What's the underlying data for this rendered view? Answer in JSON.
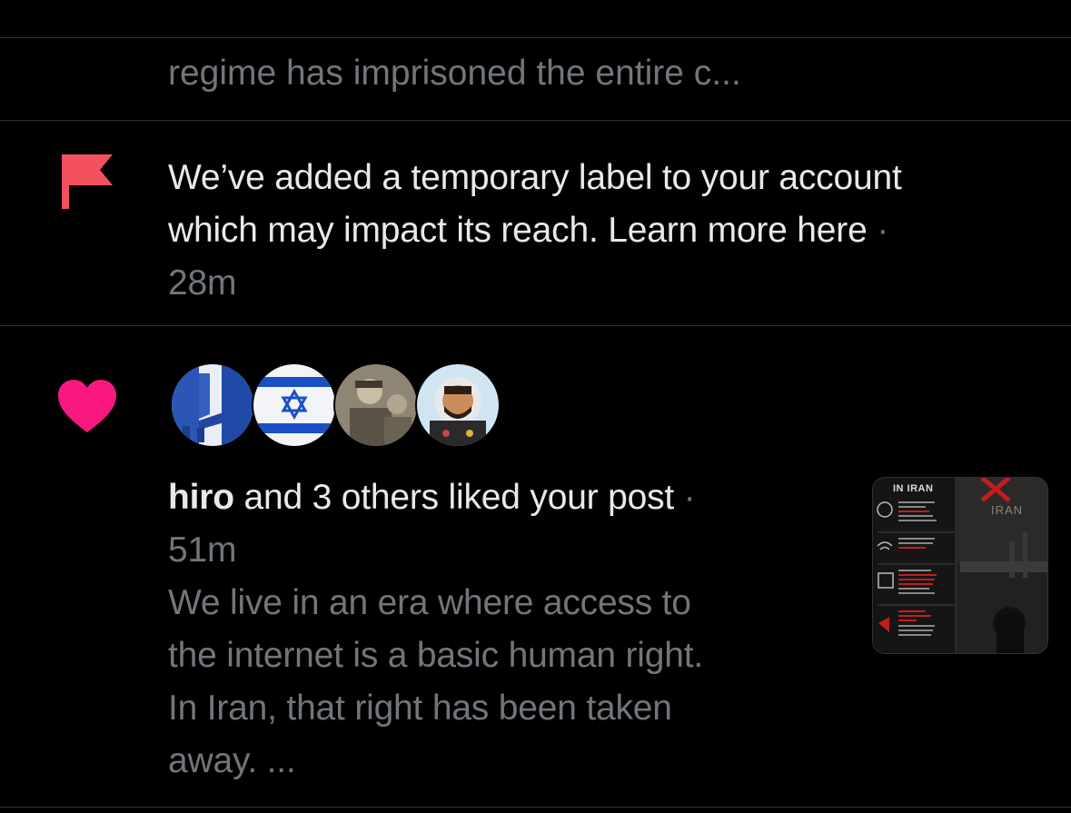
{
  "previous_item": {
    "snippet": "regime has imprisoned the entire c..."
  },
  "label_notification": {
    "icon": "flag-icon",
    "color": "#f4515f",
    "line1": "We’ve added a temporary label to your account",
    "line2_text": "which may impact its reach. ",
    "line2_link": "Learn more here",
    "separator": " ·",
    "time": "28m"
  },
  "like_notification": {
    "icon": "heart-icon",
    "color": "#f91880",
    "actor": "hiro",
    "action": " and 3 others liked your post",
    "separator": " ·",
    "time": "51m",
    "post_preview": {
      "line1": "We live in an era where access to",
      "line2": "the internet is a basic human right.",
      "line3": "In Iran, that right has been taken",
      "line4": "away.  ..."
    },
    "thumbnail": {
      "header": "IN IRAN",
      "watermark": "IRAN"
    }
  }
}
